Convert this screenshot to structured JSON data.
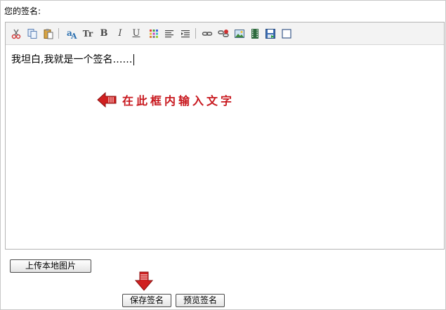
{
  "form": {
    "signature_label": "您的签名:"
  },
  "toolbar": {
    "items": [
      {
        "id": "cut",
        "icon": "scissors-icon"
      },
      {
        "id": "copy",
        "icon": "copy-icon"
      },
      {
        "id": "paste",
        "icon": "paste-icon"
      },
      {
        "id": "font-family",
        "icon": "font-family-icon"
      },
      {
        "id": "font-size",
        "icon": "font-size-icon",
        "text": "Tr"
      },
      {
        "id": "bold",
        "icon": "bold-icon",
        "text": "B"
      },
      {
        "id": "italic",
        "icon": "italic-icon",
        "text": "I"
      },
      {
        "id": "underline",
        "icon": "underline-icon",
        "text": "U"
      },
      {
        "id": "color",
        "icon": "color-palette-icon"
      },
      {
        "id": "align",
        "icon": "align-left-icon"
      },
      {
        "id": "indent",
        "icon": "indent-icon"
      },
      {
        "id": "link",
        "icon": "link-icon"
      },
      {
        "id": "unlink",
        "icon": "unlink-icon"
      },
      {
        "id": "image",
        "icon": "image-icon"
      },
      {
        "id": "video",
        "icon": "film-icon"
      },
      {
        "id": "save",
        "icon": "floppy-disk-icon"
      },
      {
        "id": "source",
        "icon": "square-icon"
      }
    ]
  },
  "editor": {
    "content": "我坦白,我就是一个签名……",
    "hint": "在此框内输入文字"
  },
  "buttons": {
    "upload": "上传本地图片",
    "save": "保存签名",
    "preview": "预览签名"
  },
  "colors": {
    "accent_red": "#c8181e",
    "toolbar_bg": "#f3f3f3",
    "border": "#b4b4b4"
  }
}
